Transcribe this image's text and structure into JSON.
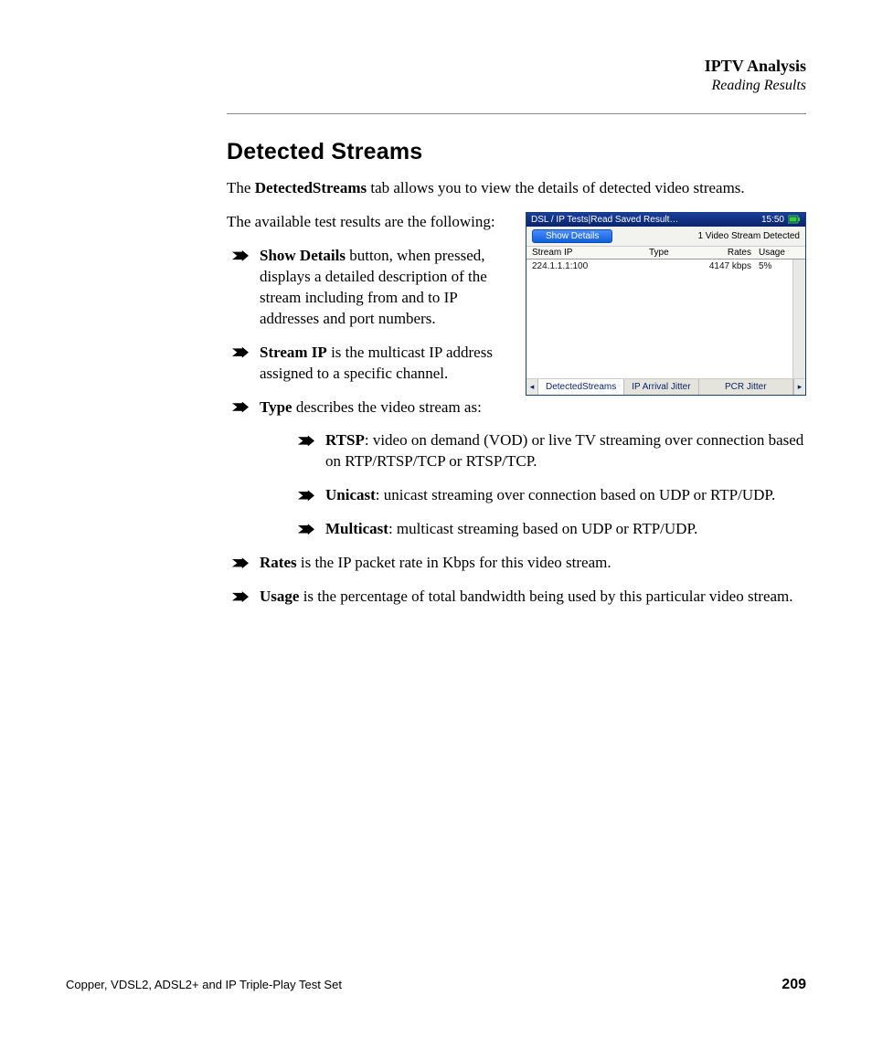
{
  "header": {
    "title": "IPTV Analysis",
    "subtitle": "Reading Results"
  },
  "heading": "Detected Streams",
  "intro1_pre": "The ",
  "intro1_bold": "DetectedStreams",
  "intro1_post": " tab allows you to view the details of detected video streams.",
  "intro2": "The available test results are the following:",
  "bullets": {
    "show_details": {
      "bold": "Show Details",
      "text": " button, when pressed, displays a detailed description of the stream including from and to IP addresses and port numbers."
    },
    "stream_ip": {
      "bold": "Stream IP",
      "text": " is the multicast IP address assigned to a specific channel."
    },
    "type": {
      "bold": "Type",
      "text": " describes the video stream as:"
    },
    "type_sub": {
      "rtsp": {
        "bold": "RTSP",
        "text": ": video on demand (VOD) or live TV streaming over connection based on RTP/RTSP/TCP or RTSP/TCP."
      },
      "unicast": {
        "bold": "Unicast",
        "text": ": unicast streaming over connection based on UDP or RTP/UDP."
      },
      "multicast": {
        "bold": "Multicast",
        "text": ": multicast streaming based on UDP or RTP/UDP."
      }
    },
    "rates": {
      "bold": "Rates",
      "text": " is the IP packet rate in Kbps for this video stream."
    },
    "usage": {
      "bold": "Usage",
      "text": " is the percentage of total bandwidth being used by this particular video stream."
    }
  },
  "screenshot": {
    "titlebar": "DSL / IP Tests|Read Saved Result…",
    "clock": "15:50",
    "button": "Show Details",
    "status": "1 Video Stream Detected",
    "cols": {
      "ip": "Stream IP",
      "type": "Type",
      "rates": "Rates",
      "usage": "Usage"
    },
    "row": {
      "ip": "224.1.1.1:100",
      "type": "",
      "rates": "4147 kbps",
      "usage": "5%"
    },
    "tabs": {
      "t1": "DetectedStreams",
      "t2": "IP Arrival Jitter",
      "t3": "PCR Jitter"
    }
  },
  "footer": {
    "title": "Copper, VDSL2, ADSL2+ and IP Triple-Play Test Set",
    "page": "209"
  }
}
